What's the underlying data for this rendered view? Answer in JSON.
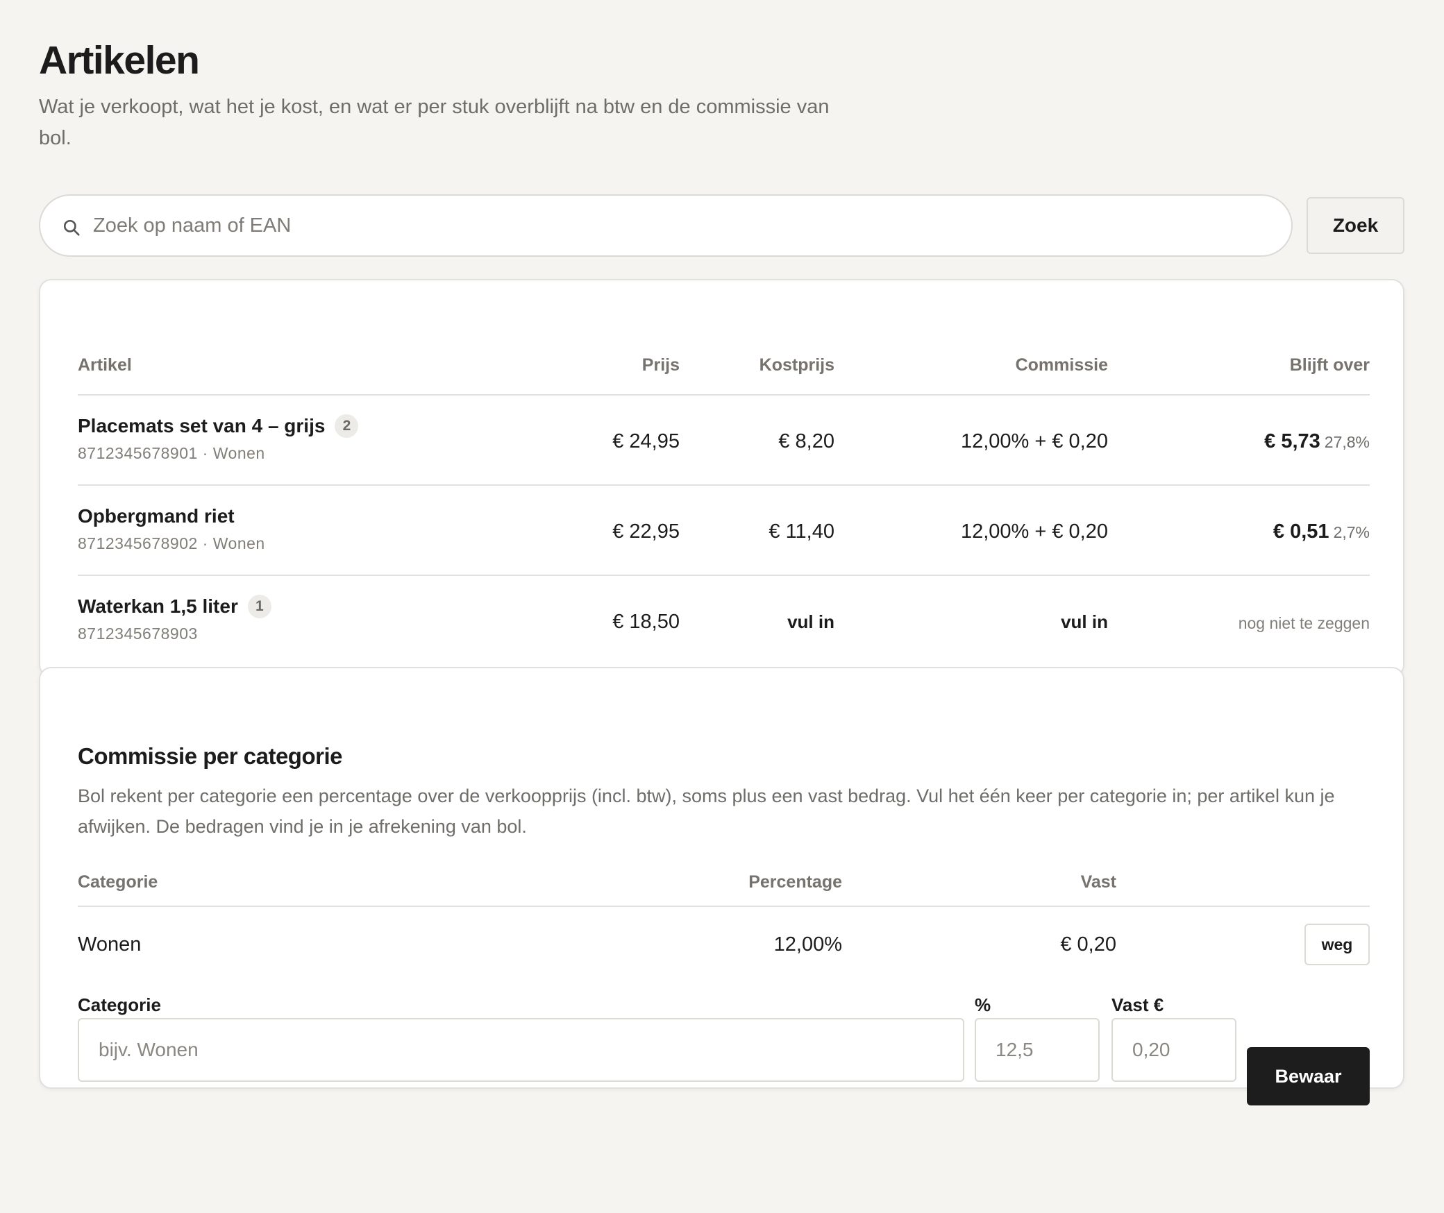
{
  "header": {
    "title": "Artikelen",
    "subtitle": "Wat je verkoopt, wat het je kost, en wat er per stuk overblijft na btw en de commissie van bol."
  },
  "search": {
    "placeholder": "Zoek op naam of EAN",
    "value": "",
    "button_label": "Zoek",
    "icon": "search-icon"
  },
  "articles": {
    "columns": {
      "name": "Artikel",
      "price": "Prijs",
      "cost": "Kostprijs",
      "commission": "Commissie",
      "remaining": "Blijft over"
    },
    "rows": [
      {
        "name": "Placemats set van 4 – grijs",
        "badge": "2",
        "meta": "8712345678901 · Wonen",
        "price": "€ 24,95",
        "cost": "€ 8,20",
        "commission": "12,00% + € 0,20",
        "remaining": "€ 5,73",
        "remaining_pct": "27,8%"
      },
      {
        "name": "Opbergmand riet",
        "badge": "",
        "meta": "8712345678902 · Wonen",
        "price": "€ 22,95",
        "cost": "€ 11,40",
        "commission": "12,00% + € 0,20",
        "remaining": "€ 0,51",
        "remaining_pct": "2,7%"
      },
      {
        "name": "Waterkan 1,5 liter",
        "badge": "1",
        "meta": "8712345678903",
        "price": "€ 18,50",
        "cost": "vul in",
        "commission": "vul in",
        "remaining_text": "nog niet te zeggen"
      }
    ]
  },
  "commission": {
    "title": "Commissie per categorie",
    "description": "Bol rekent per categorie een percentage over de verkoopprijs (incl. btw), soms plus een vast bedrag. Vul het één keer per categorie in; per artikel kun je afwijken. De bedragen vind je in je afrekening van bol.",
    "columns": {
      "category": "Categorie",
      "percentage": "Percentage",
      "fixed": "Vast"
    },
    "rows": [
      {
        "category": "Wonen",
        "percentage": "12,00%",
        "fixed": "€ 0,20",
        "delete_label": "weg"
      }
    ],
    "form": {
      "category_label": "Categorie",
      "category_placeholder": "bijv. Wonen",
      "pct_label": "%",
      "pct_placeholder": "12,5",
      "fixed_label": "Vast €",
      "fixed_placeholder": "0,20",
      "save_label": "Bewaar"
    }
  }
}
